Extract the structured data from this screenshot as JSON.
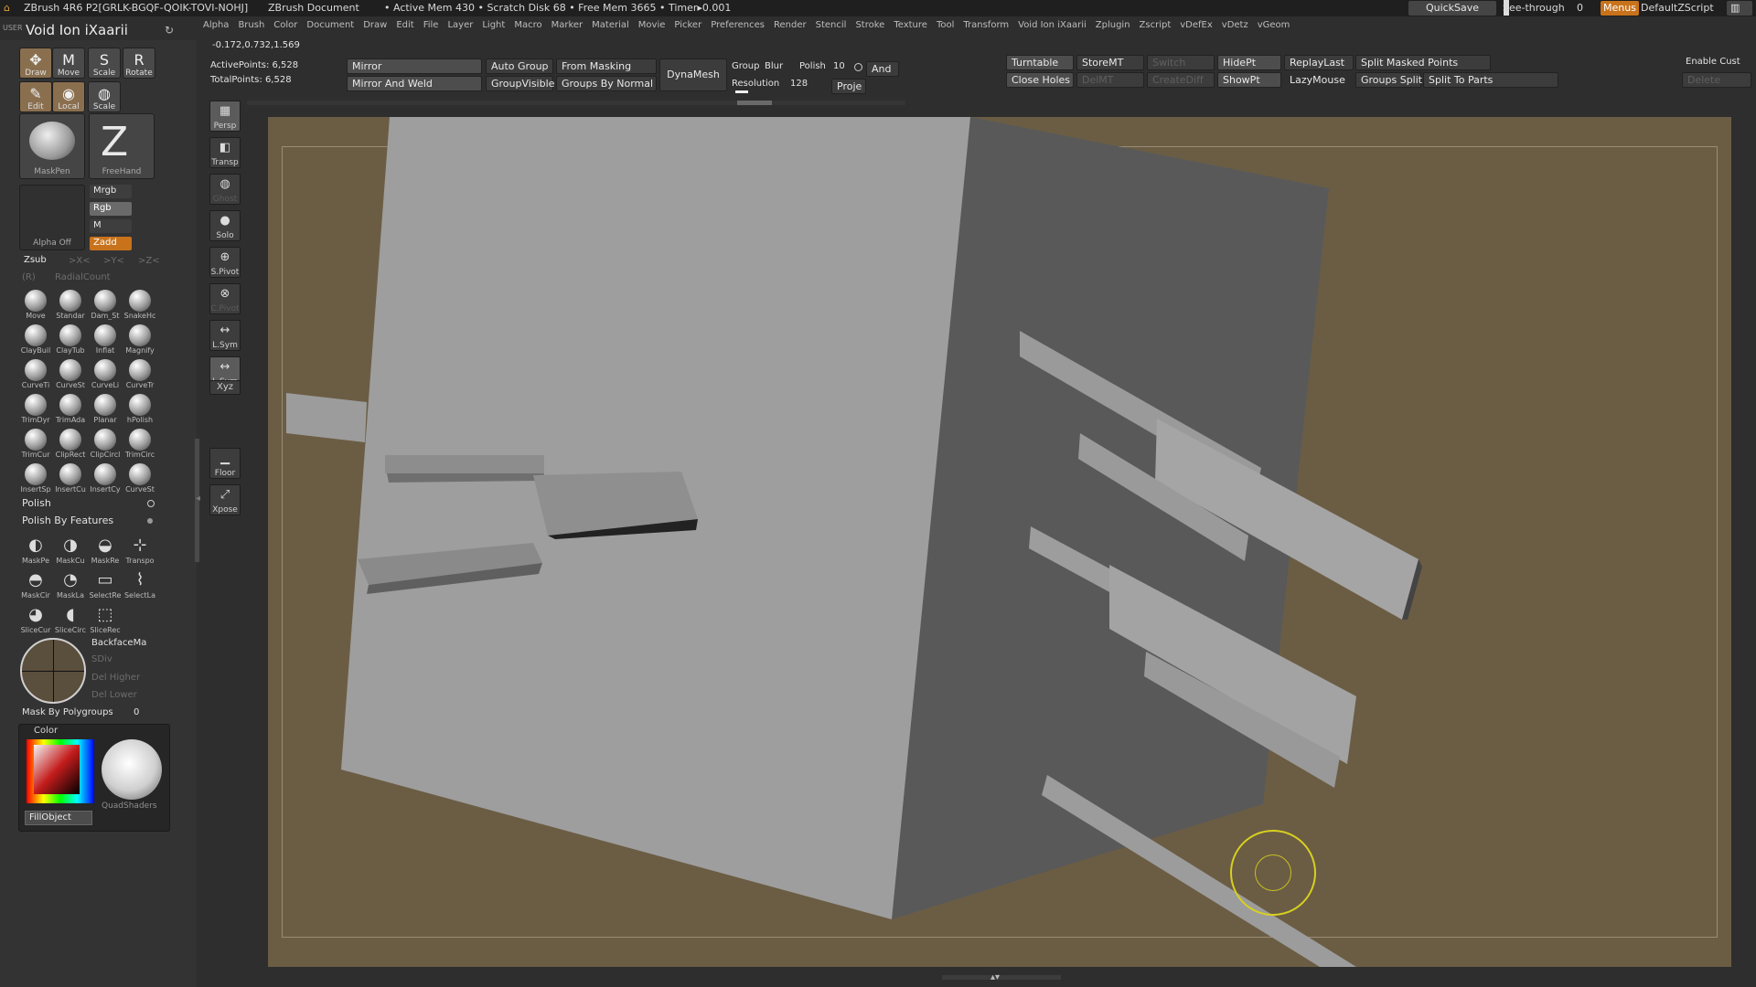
{
  "title_bar": {
    "app": "ZBrush 4R6 P2[GRLK-BGQF-QOIK-TOVI-NOHJ]",
    "document": "ZBrush Document",
    "status": "• Active Mem 430 • Scratch Disk 68 • Free Mem 3665 • Timer▸0.001",
    "quicksave": "QuickSave",
    "see_through": "See-through",
    "see_through_value": "0",
    "menus": "Menus",
    "script": "DefaultZScript"
  },
  "menubar": [
    "Alpha",
    "Brush",
    "Color",
    "Document",
    "Draw",
    "Edit",
    "File",
    "Layer",
    "Light",
    "Macro",
    "Marker",
    "Material",
    "Movie",
    "Picker",
    "Preferences",
    "Render",
    "Stencil",
    "Stroke",
    "Texture",
    "Tool",
    "Transform",
    "Void Ion iXaarii",
    "Zplugin",
    "Zscript",
    "vDefEx",
    "vDetz",
    "vGeom"
  ],
  "tool_panel": {
    "user_label": "USER",
    "tool_name": "Void Ion iXaarii",
    "coords": "-0.172,0.732,1.569"
  },
  "tools": [
    {
      "label": "Draw",
      "icon": "draw-icon",
      "glyph": "✥"
    },
    {
      "label": "Move",
      "icon": "move-icon",
      "glyph": "M"
    },
    {
      "label": "Scale",
      "icon": "scale-icon",
      "glyph": "S"
    },
    {
      "label": "Rotate",
      "icon": "rotate-icon",
      "glyph": "R"
    },
    {
      "label": "Edit",
      "icon": "edit-icon",
      "glyph": "✎"
    },
    {
      "label": "Local",
      "icon": "local-icon",
      "glyph": "◉"
    },
    {
      "label": "Scale",
      "icon": "scale-icon",
      "glyph": "◍"
    }
  ],
  "brush_slots": {
    "brush": "MaskPen",
    "stroke": "FreeHand",
    "alpha": "Alpha  Off"
  },
  "color_modes": {
    "mrgb": "Mrgb",
    "rgb": "Rgb",
    "m": "M",
    "zadd": "Zadd",
    "zsub": "Zsub"
  },
  "sym_labels": [
    "(R)",
    "RadialCount",
    ">X<",
    ">Y<",
    ">Z<"
  ],
  "brushes": [
    "Move",
    "Standar",
    "Dam_St",
    "SnakeHc",
    "ClayBuil",
    "ClayTub",
    "Inflat",
    "Magnify",
    "CurveTi",
    "CurveSt",
    "CurveLi",
    "CurveTr",
    "TrimDyr",
    "TrimAda",
    "Planar",
    "hPolish",
    "TrimCur",
    "ClipRect",
    "ClipCircl",
    "TrimCirc",
    "InsertSp",
    "InsertCu",
    "InsertCy",
    "CurveSt"
  ],
  "polish": {
    "label": "Polish",
    "features": "Polish By Features"
  },
  "mask_brushes": [
    "MaskPe",
    "MaskCu",
    "MaskRe",
    "Transpo",
    "MaskCir",
    "MaskLa",
    "SelectRe",
    "SelectLa",
    "SliceCur",
    "SliceCirc",
    "SliceRec"
  ],
  "subdiv": {
    "backface": "BackfaceMa",
    "sdiv": "SDiv",
    "del_higher": "Del Higher",
    "del_lower": "Del Lower"
  },
  "mask_by_polygroups": {
    "label": "Mask By Polygroups",
    "value": "0"
  },
  "color_panel": {
    "title": "Color",
    "material": "QuadShaders",
    "fill": "FillObject",
    "current_color": "#2a2a2a"
  },
  "stats": {
    "active": "ActivePoints: 6,528",
    "total": "TotalPoints: 6,528"
  },
  "palette_buttons": {
    "mirror": "Mirror",
    "mirror_weld": "Mirror And Weld",
    "auto_group": "Auto Group",
    "group_visible": "GroupVisible",
    "from_masking": "From Masking",
    "groups_by_normal": "Groups By Normal",
    "dynamesh": "DynaMesh",
    "group": "Group",
    "blur": "Blur",
    "polish": "Polish",
    "polish_value": "10",
    "resolution": "Resolution",
    "resolution_value": "128",
    "and": "And",
    "project": "Proje",
    "turntable": "Turntable",
    "storemt": "StoreMT",
    "switch": "Switch",
    "close_holes": "Close Holes",
    "delmt": "DelMT",
    "creatediff": "CreateDiff",
    "hidept": "HidePt",
    "showpt": "ShowPt",
    "replaylast": "ReplayLast",
    "lazymouse": "LazyMouse",
    "split_masked": "Split Masked Points",
    "groups_split": "Groups Split",
    "split_to_parts": "Split To Parts",
    "enable_custom": "Enable Cust",
    "delete": "Delete"
  },
  "shelf": [
    {
      "label": "Persp",
      "icon": "persp-icon",
      "glyph": "▦",
      "state": "sel"
    },
    {
      "label": "Transp",
      "icon": "transp-icon",
      "glyph": "◧",
      "state": "normal"
    },
    {
      "label": "Ghost",
      "icon": "ghost-icon",
      "glyph": "◍",
      "state": "dis"
    },
    {
      "label": "Solo",
      "icon": "solo-icon",
      "glyph": "●",
      "state": "normal"
    },
    {
      "label": "S.Pivot",
      "icon": "pivot-icon",
      "glyph": "⊕",
      "state": "normal"
    },
    {
      "label": "C.Pivot",
      "icon": "cpivot-icon",
      "glyph": "⊗",
      "state": "dis"
    },
    {
      "label": "L.Sym",
      "icon": "lsym-icon",
      "glyph": "↔",
      "state": "normal"
    },
    {
      "label": "L.Sym",
      "icon": "lsym-icon",
      "glyph": "↔",
      "state": "sel"
    },
    {
      "label": "Xyz",
      "icon": "xyz-icon",
      "glyph": "",
      "state": "normal"
    },
    {
      "label": "Floor",
      "icon": "floor-icon",
      "glyph": "▁",
      "state": "normal"
    },
    {
      "label": "Xpose",
      "icon": "xpose-icon",
      "glyph": "⤢",
      "state": "normal"
    }
  ]
}
